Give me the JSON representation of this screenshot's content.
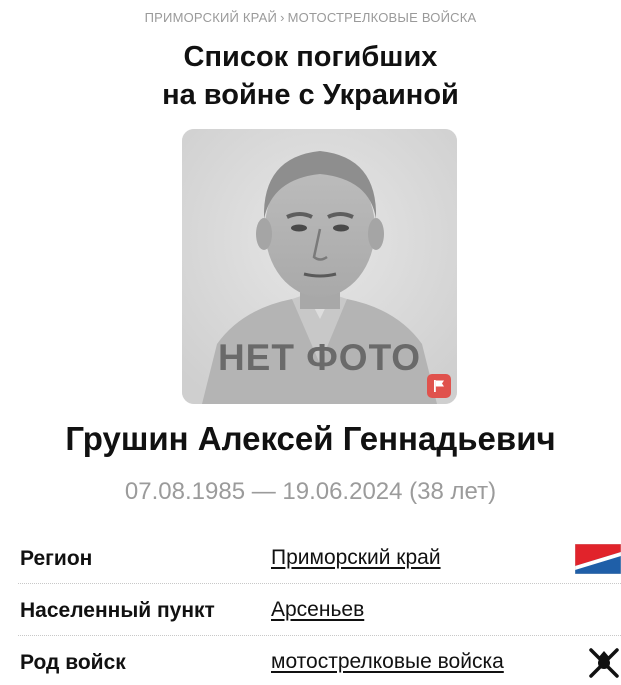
{
  "breadcrumb": {
    "region": "ПРИМОРСКИЙ КРАЙ",
    "separator": "›",
    "branch": "МОТОСТРЕЛКОВЫЕ ВОЙСКА"
  },
  "header": {
    "title_line1": "Список погибших",
    "title_line2": "на войне с Украиной"
  },
  "photo": {
    "placeholder_text": "НЕТ ФОТО",
    "badge_icon": "flag-icon",
    "badge_color": "#e0524d"
  },
  "person": {
    "name": "Грушин Алексей Геннадьевич",
    "dates": "07.08.1985 — 19.06.2024 (38 лет)"
  },
  "details": [
    {
      "label": "Регион",
      "value": "Приморский край",
      "icon": "region-flag-icon"
    },
    {
      "label": "Населенный пункт",
      "value": "Арсеньев"
    },
    {
      "label": "Род войск",
      "value": "мотострелковые войска",
      "icon": "motor-rifle-emblem-icon"
    }
  ],
  "colors": {
    "muted_text": "#9b9b9b",
    "flag_red": "#e1232b",
    "flag_blue": "#1f5fa8",
    "flag_white": "#ffffff"
  }
}
